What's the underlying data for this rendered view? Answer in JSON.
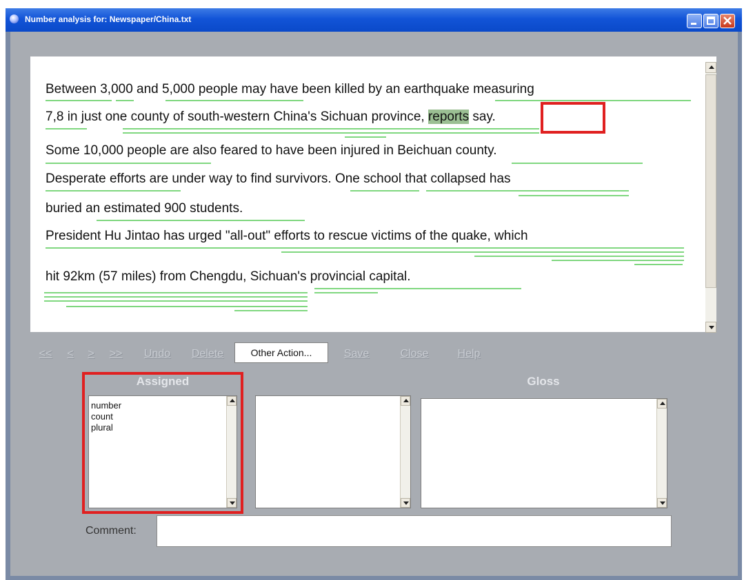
{
  "window": {
    "title": "Number analysis for: Newspaper/China.txt"
  },
  "text": {
    "lines": [
      {
        "text": "Between 3,000 and 5,000 people may have been killed by an earthquake measuring"
      },
      {
        "before": "7,8 in just one county of south-western China's Sichuan province, ",
        "selected": "reports",
        "after": " say."
      },
      {
        "text": "Some 10,000 people are also feared to have been injured in Beichuan county."
      },
      {
        "text": "Desperate efforts are under way to find survivors. One school that collapsed has"
      },
      {
        "text": "buried an estimated 900 students."
      },
      {
        "text": "President Hu Jintao has urged \"all-out\" efforts to rescue victims of the quake, which"
      },
      {
        "text": "hit 92km (57 miles) from Chengdu, Sichuan's provincial capital."
      }
    ]
  },
  "toolbar": {
    "buttons": [
      "<<",
      "<",
      ">",
      ">>",
      "Undo",
      "Delete",
      "Save",
      "Close",
      "Help"
    ],
    "other_action": "Other Action..."
  },
  "panels": {
    "assigned": {
      "label": "Assigned",
      "items": [
        "number",
        "count",
        "plural"
      ]
    },
    "gloss": {
      "label": "Gloss"
    }
  },
  "comment": {
    "label": "Comment:",
    "value": ""
  },
  "colors": {
    "highlight": "#e02020",
    "underline": "#7fd77f",
    "selection": "#9bbf93"
  }
}
